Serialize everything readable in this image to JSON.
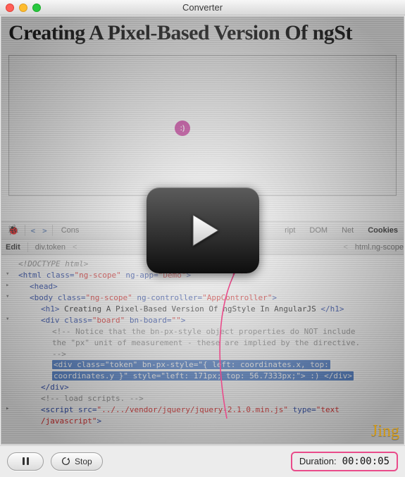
{
  "window": {
    "title": "Converter"
  },
  "page": {
    "headline": "Creating A Pixel-Based Version Of ngSt",
    "token_face": ":)"
  },
  "devtools": {
    "tabs": {
      "console": "Cons",
      "script": "ript",
      "dom": "DOM",
      "net": "Net",
      "cookies": "Cookies"
    },
    "subbar": {
      "edit": "Edit",
      "crumb1": "div.token",
      "crumb3": "html.ng-scope"
    },
    "lines": {
      "doctype": "<!DOCTYPE html>",
      "html_open": "<html class=\"ng-scope\" ng-app=\"Demo\">",
      "head": "<head>",
      "body_open": "<body class=\"ng-scope\" ng-controller=\"AppController\">",
      "h1": "<h1> Creating A Pixel-Based Version Of ngStyle In AngularJS </h1>",
      "div_board_open": "<div class=\"board\" bn-board=\"\">",
      "comment1": "<!-- Notice that the bn-px-style object properties do NOT include",
      "comment2": "the \"px\" unit of measurement - these are implied by the directive.",
      "comment3": "-->",
      "token_line": "<div class=\"token\" bn-px-style=\"{ left: coordinates.x, top: coordinates.y }\" style=\"left: 171px; top: 56.7333px;\"> :) </div>",
      "div_close": "</div>",
      "load_scripts": "<!-- load scripts. -->",
      "script_open": "<script src=\"../../vendor/jquery/jquery-2.1.0.min.js\" type=\"text",
      "script_close": "/javascript\">"
    }
  },
  "watermark": "Jing",
  "controls": {
    "pause": "Pause",
    "stop": "Stop",
    "duration_label": "Duration:",
    "duration_value": "00:00:05"
  }
}
